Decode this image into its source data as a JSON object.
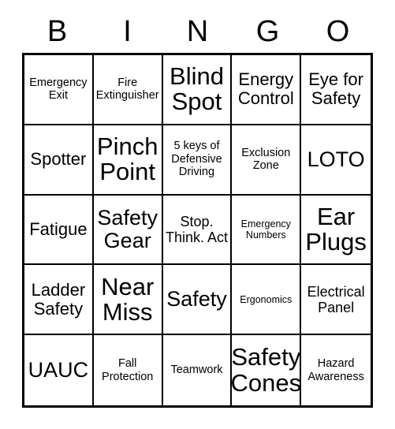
{
  "card": {
    "header": {
      "letters": [
        "B",
        "I",
        "N",
        "G",
        "O"
      ]
    },
    "grid": {
      "rows": 5,
      "columns": 5,
      "cells": [
        {
          "text": "Emergency Exit",
          "size": "sm"
        },
        {
          "text": "Fire Extinguisher",
          "size": "sm"
        },
        {
          "text": "Blind Spot",
          "size": "xxl"
        },
        {
          "text": "Energy Control",
          "size": "lg"
        },
        {
          "text": "Eye for Safety",
          "size": "lg"
        },
        {
          "text": "Spotter",
          "size": "lg"
        },
        {
          "text": "Pinch Point",
          "size": "xxl"
        },
        {
          "text": "5 keys of Defensive Driving",
          "size": "sm"
        },
        {
          "text": "Exclusion Zone",
          "size": "sm"
        },
        {
          "text": "LOTO",
          "size": "xl"
        },
        {
          "text": "Fatigue",
          "size": "lg"
        },
        {
          "text": "Safety Gear",
          "size": "xl"
        },
        {
          "text": "Stop. Think. Act",
          "size": "md"
        },
        {
          "text": "Emergency Numbers",
          "size": "xs"
        },
        {
          "text": "Ear Plugs",
          "size": "xxl"
        },
        {
          "text": "Ladder Safety",
          "size": "lg"
        },
        {
          "text": "Near Miss",
          "size": "xxl"
        },
        {
          "text": "Safety",
          "size": "xl"
        },
        {
          "text": "Ergonomics",
          "size": "xs"
        },
        {
          "text": "Electrical Panel",
          "size": "md"
        },
        {
          "text": "UAUC",
          "size": "xl"
        },
        {
          "text": "Fall Protection",
          "size": "sm"
        },
        {
          "text": "Teamwork",
          "size": "sm"
        },
        {
          "text": "Safety Cones",
          "size": "xxl"
        },
        {
          "text": "Hazard Awareness",
          "size": "sm"
        }
      ]
    },
    "colors": {
      "background": "#ffffff",
      "text": "#000000",
      "border": "#000000"
    }
  }
}
